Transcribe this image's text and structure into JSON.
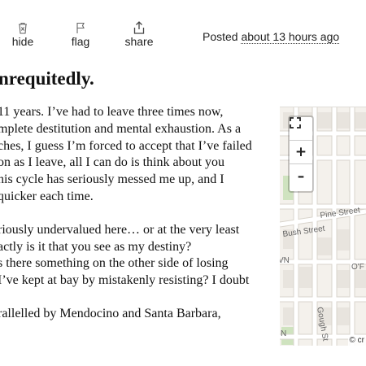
{
  "actions": {
    "hide": {
      "label": "hide",
      "icon": "trash-x-icon"
    },
    "flag": {
      "label": "flag",
      "icon": "flag-icon"
    },
    "share": {
      "label": "share",
      "icon": "share-icon"
    }
  },
  "posted": {
    "prefix": "Posted ",
    "time": "about 13 hours ago"
  },
  "post": {
    "title": "nrequitedly.",
    "paragraphs": [
      [
        "11 years. I’ve had to leave three times now,",
        "mplete destitution and mental exhaustion. As a",
        "ches, I guess I’m forced to accept that I’ve failed",
        "on as I leave, all I can do is think about you",
        "his cycle has seriously messed me up, and I",
        "quicker each time."
      ],
      [
        "riously undervalued here… or at the very least",
        "actly is it that you see as my destiny?",
        "s there something on the other side of losing",
        "I’ve kept at bay by mistakenly resisting? I doubt"
      ],
      [
        "rallelled by Mendocino and Santa Barbara,"
      ]
    ]
  },
  "map": {
    "controls": {
      "fullscreen": "⛶",
      "zoom_in": "+",
      "zoom_out": "–"
    },
    "street_labels": [
      "Pine Street",
      "Bush Street",
      "O'F",
      "Gough St",
      "VN",
      "N"
    ],
    "attribution": "© cr",
    "colors": {
      "land": "#f4f1ec",
      "road": "#ffffff",
      "road_edge": "#d9d4cc",
      "park": "#cfe3bf"
    }
  }
}
